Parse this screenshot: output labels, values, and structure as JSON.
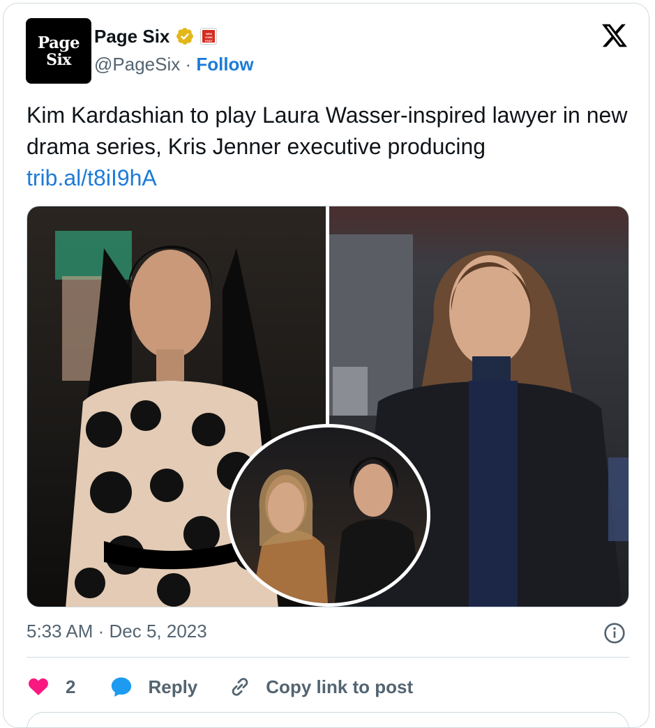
{
  "author": {
    "avatar_line1": "Page",
    "avatar_line2": "Six",
    "display_name": "Page Six",
    "handle": "@PageSix",
    "separator": " · ",
    "follow_label": "Follow",
    "affiliate_badge_text": "NEW YORK POST"
  },
  "tweet": {
    "text": "Kim Kardashian to play Laura Wasser-inspired lawyer in new drama series, Kris Jenner executive producing",
    "link": "trib.al/t8iI9hA",
    "timestamp": "5:33 AM · Dec 5, 2023"
  },
  "actions": {
    "like_count": "2",
    "reply_label": "Reply",
    "copy_link_label": "Copy link to post"
  },
  "colors": {
    "link": "#1d7bd8",
    "secondary_text": "#536471",
    "like": "#f91880",
    "reply": "#1d9bf0",
    "verified": "#e2b719"
  },
  "icons": [
    "x-logo-icon",
    "verified-badge-icon",
    "info-icon",
    "heart-icon",
    "reply-bubble-icon",
    "link-icon"
  ]
}
